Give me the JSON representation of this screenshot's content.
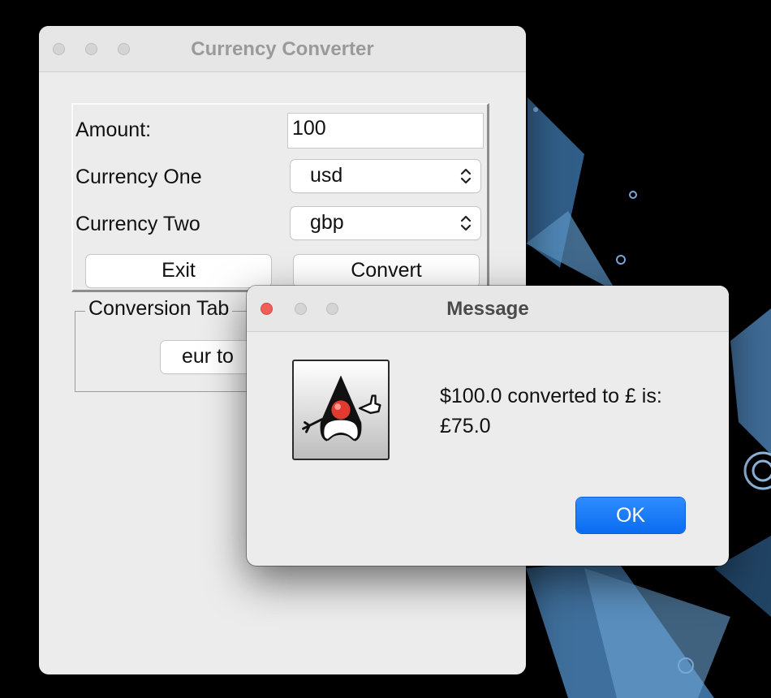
{
  "main_window": {
    "title": "Currency Converter",
    "amount_label": "Amount:",
    "amount_value": "100",
    "currency_one_label": "Currency One",
    "currency_one_value": "usd",
    "currency_two_label": "Currency Two",
    "currency_two_value": "gbp",
    "exit_label": "Exit",
    "convert_label": "Convert",
    "conversion_table_title": "Conversion Tab",
    "conversion_table_button": "eur to"
  },
  "dialog": {
    "title": "Message",
    "message_line1": "$100.0 converted to £ is:",
    "message_line2": "£75.0",
    "ok_label": "OK",
    "icon": "duke-icon"
  },
  "colors": {
    "desktop": "#000000",
    "window_bg": "#ececec",
    "ok_button": "#0a6cf0",
    "close_red": "#ee5f57"
  }
}
